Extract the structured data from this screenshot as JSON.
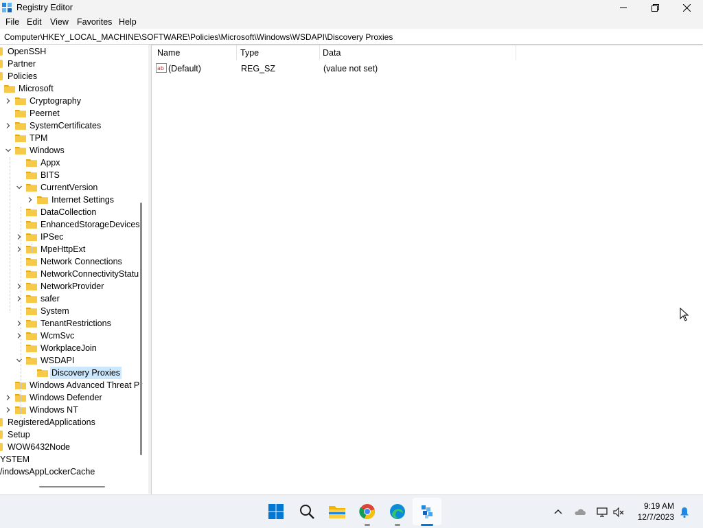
{
  "window": {
    "title": "Registry Editor"
  },
  "menu": {
    "file": "File",
    "edit": "Edit",
    "view": "View",
    "favorites": "Favorites",
    "help": "Help"
  },
  "address": {
    "path": "Computer\\HKEY_LOCAL_MACHINE\\SOFTWARE\\Policies\\Microsoft\\Windows\\WSDAPI\\Discovery Proxies"
  },
  "tree": {
    "items": [
      {
        "label": "OpenSSH",
        "state": "partial-left"
      },
      {
        "label": "Partner",
        "state": "partial-left"
      },
      {
        "label": "Policies",
        "state": "partial-left"
      },
      {
        "label": "Microsoft",
        "state": "expanded"
      },
      {
        "label": "Cryptography",
        "state": "collapsed"
      },
      {
        "label": "Peernet",
        "state": "leaf"
      },
      {
        "label": "SystemCertificates",
        "state": "collapsed"
      },
      {
        "label": "TPM",
        "state": "leaf"
      },
      {
        "label": "Windows",
        "state": "expanded"
      },
      {
        "label": "Appx",
        "state": "leaf"
      },
      {
        "label": "BITS",
        "state": "leaf"
      },
      {
        "label": "CurrentVersion",
        "state": "expanded"
      },
      {
        "label": "Internet Settings",
        "state": "collapsed"
      },
      {
        "label": "DataCollection",
        "state": "leaf"
      },
      {
        "label": "EnhancedStorageDevices",
        "state": "leaf"
      },
      {
        "label": "IPSec",
        "state": "collapsed"
      },
      {
        "label": "MpeHttpExt",
        "state": "collapsed"
      },
      {
        "label": "Network Connections",
        "state": "leaf"
      },
      {
        "label": "NetworkConnectivityStatu",
        "state": "leaf"
      },
      {
        "label": "NetworkProvider",
        "state": "collapsed"
      },
      {
        "label": "safer",
        "state": "collapsed"
      },
      {
        "label": "System",
        "state": "leaf"
      },
      {
        "label": "TenantRestrictions",
        "state": "collapsed"
      },
      {
        "label": "WcmSvc",
        "state": "collapsed"
      },
      {
        "label": "WorkplaceJoin",
        "state": "leaf"
      },
      {
        "label": "WSDAPI",
        "state": "expanded"
      },
      {
        "label": "Discovery Proxies",
        "state": "selected"
      },
      {
        "label": "Windows Advanced Threat Pr",
        "state": "leaf"
      },
      {
        "label": "Windows Defender",
        "state": "collapsed"
      },
      {
        "label": "Windows NT",
        "state": "collapsed"
      },
      {
        "label": "RegisteredApplications",
        "state": "partial-left"
      },
      {
        "label": "Setup",
        "state": "partial-left"
      },
      {
        "label": "WOW6432Node",
        "state": "partial-left"
      },
      {
        "label": "YSTEM",
        "state": "cut"
      },
      {
        "label": "/indowsAppLockerCache",
        "state": "cut"
      }
    ]
  },
  "list": {
    "columns": {
      "name": "Name",
      "type": "Type",
      "data": "Data"
    },
    "rows": [
      {
        "name": "(Default)",
        "type": "REG_SZ",
        "data": "(value not set)"
      }
    ]
  },
  "taskbar": {
    "apps": [
      "start-icon",
      "search-icon",
      "file-explorer-icon",
      "chrome-icon",
      "edge-icon",
      "registry-editor-icon"
    ],
    "clock": {
      "time": "9:19 AM",
      "date": "12/7/2023"
    }
  },
  "colors": {
    "selection": "#cce8ff",
    "folder": "#f7c948",
    "accent": "#0078d4"
  }
}
